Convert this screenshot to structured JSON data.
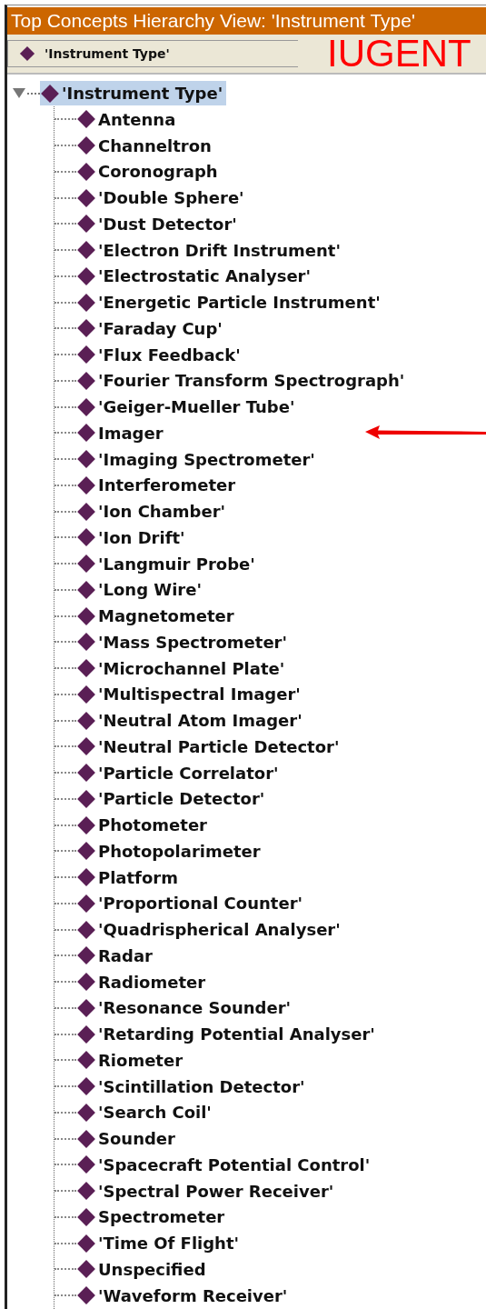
{
  "window": {
    "title": "Top Concepts Hierarchy View: 'Instrument Type'"
  },
  "toolbar": {
    "label": "'Instrument Type'",
    "annotation": "IUGENT"
  },
  "tree": {
    "label": "'Instrument Type'",
    "expanded": true,
    "selected": true,
    "children": [
      {
        "label": "Antenna",
        "marked": false
      },
      {
        "label": "Channeltron",
        "marked": false
      },
      {
        "label": "Coronograph",
        "marked": false
      },
      {
        "label": "'Double Sphere'",
        "marked": false
      },
      {
        "label": "'Dust Detector'",
        "marked": false
      },
      {
        "label": "'Electron Drift Instrument'",
        "marked": false
      },
      {
        "label": "'Electrostatic Analyser'",
        "marked": false
      },
      {
        "label": "'Energetic Particle Instrument'",
        "marked": false
      },
      {
        "label": "'Faraday Cup'",
        "marked": false
      },
      {
        "label": "'Flux Feedback'",
        "marked": false
      },
      {
        "label": "'Fourier Transform Spectrograph'",
        "marked": false
      },
      {
        "label": "'Geiger-Mueller Tube'",
        "marked": false
      },
      {
        "label": "Imager",
        "marked": true
      },
      {
        "label": "'Imaging Spectrometer'",
        "marked": false
      },
      {
        "label": "Interferometer",
        "marked": false
      },
      {
        "label": "'Ion Chamber'",
        "marked": false
      },
      {
        "label": "'Ion Drift'",
        "marked": false
      },
      {
        "label": "'Langmuir Probe'",
        "marked": false
      },
      {
        "label": "'Long Wire'",
        "marked": false
      },
      {
        "label": "Magnetometer",
        "marked": false
      },
      {
        "label": "'Mass Spectrometer'",
        "marked": false
      },
      {
        "label": "'Microchannel Plate'",
        "marked": false
      },
      {
        "label": "'Multispectral Imager'",
        "marked": false
      },
      {
        "label": "'Neutral Atom Imager'",
        "marked": false
      },
      {
        "label": "'Neutral Particle Detector'",
        "marked": false
      },
      {
        "label": "'Particle Correlator'",
        "marked": false
      },
      {
        "label": "'Particle Detector'",
        "marked": false
      },
      {
        "label": "Photometer",
        "marked": false
      },
      {
        "label": "Photopolarimeter",
        "marked": false
      },
      {
        "label": "Platform",
        "marked": false
      },
      {
        "label": "'Proportional Counter'",
        "marked": false
      },
      {
        "label": "'Quadrispherical Analyser'",
        "marked": false
      },
      {
        "label": "Radar",
        "marked": false
      },
      {
        "label": "Radiometer",
        "marked": false
      },
      {
        "label": "'Resonance Sounder'",
        "marked": false
      },
      {
        "label": "'Retarding Potential Analyser'",
        "marked": false
      },
      {
        "label": "Riometer",
        "marked": false
      },
      {
        "label": "'Scintillation Detector'",
        "marked": false
      },
      {
        "label": "'Search Coil'",
        "marked": false
      },
      {
        "label": "Sounder",
        "marked": false
      },
      {
        "label": "'Spacecraft Potential Control'",
        "marked": false
      },
      {
        "label": "'Spectral Power Receiver'",
        "marked": false
      },
      {
        "label": "Spectrometer",
        "marked": false
      },
      {
        "label": "'Time Of Flight'",
        "marked": false
      },
      {
        "label": "Unspecified",
        "marked": false
      },
      {
        "label": "'Waveform Receiver'",
        "marked": false
      }
    ]
  }
}
